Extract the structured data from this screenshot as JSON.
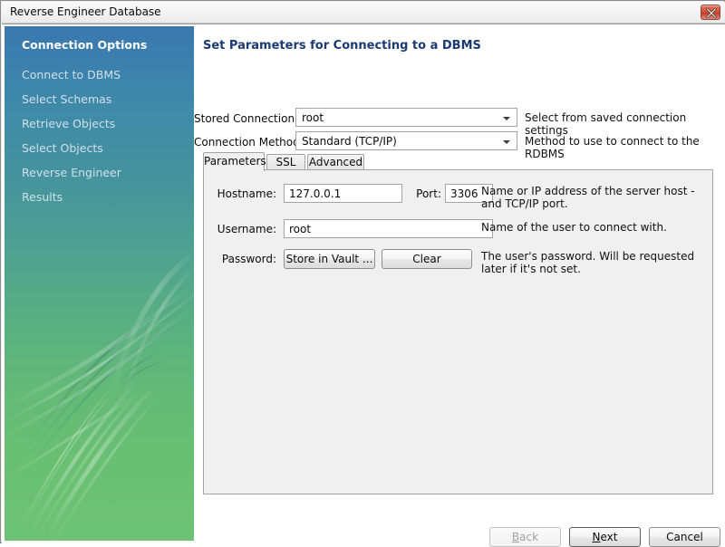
{
  "window": {
    "title": "Reverse Engineer Database",
    "close_icon": "close-icon",
    "close_label": "Close"
  },
  "sidebar": {
    "items": [
      {
        "label": "Connection Options",
        "active": true
      },
      {
        "label": "Connect to DBMS",
        "active": false
      },
      {
        "label": "Select Schemas",
        "active": false
      },
      {
        "label": "Retrieve Objects",
        "active": false
      },
      {
        "label": "Select Objects",
        "active": false
      },
      {
        "label": "Reverse Engineer",
        "active": false
      },
      {
        "label": "Results",
        "active": false
      }
    ],
    "gradient_top": "#3a77ad",
    "gradient_bottom": "#6dc275"
  },
  "content": {
    "page_title": "Set Parameters for Connecting to a DBMS",
    "title_color": "#1b3a74",
    "stored_connection": {
      "label": "Stored Connection:",
      "value": "root",
      "hint": "Select from saved connection settings"
    },
    "connection_method": {
      "label": "Connection Method:",
      "value": "Standard (TCP/IP)",
      "hint": "Method to use to connect to the RDBMS"
    },
    "tabs": [
      {
        "label": "Parameters",
        "selected": true
      },
      {
        "label": "SSL",
        "selected": false
      },
      {
        "label": "Advanced",
        "selected": false
      }
    ],
    "parameters": {
      "hostname": {
        "label": "Hostname:",
        "value": "127.0.0.1",
        "placeholder": "127.0.0.1"
      },
      "port": {
        "label": "Port:",
        "value": "3306",
        "placeholder": "3306"
      },
      "hostname_hint": "Name or IP address of the server host - and TCP/IP port.",
      "username": {
        "label": "Username:",
        "value": "root",
        "placeholder": "root"
      },
      "username_hint": "Name of the user to connect with.",
      "password": {
        "label": "Password:",
        "store_button": "Store in Vault ...",
        "clear_button": "Clear"
      },
      "password_hint": "The user's password. Will be requested later if it's not set."
    }
  },
  "footer": {
    "back": {
      "label": "Back",
      "mnemonic": "B",
      "disabled": true
    },
    "next": {
      "label": "Next",
      "mnemonic": "N",
      "default": true
    },
    "cancel": {
      "label": "Cancel"
    }
  }
}
